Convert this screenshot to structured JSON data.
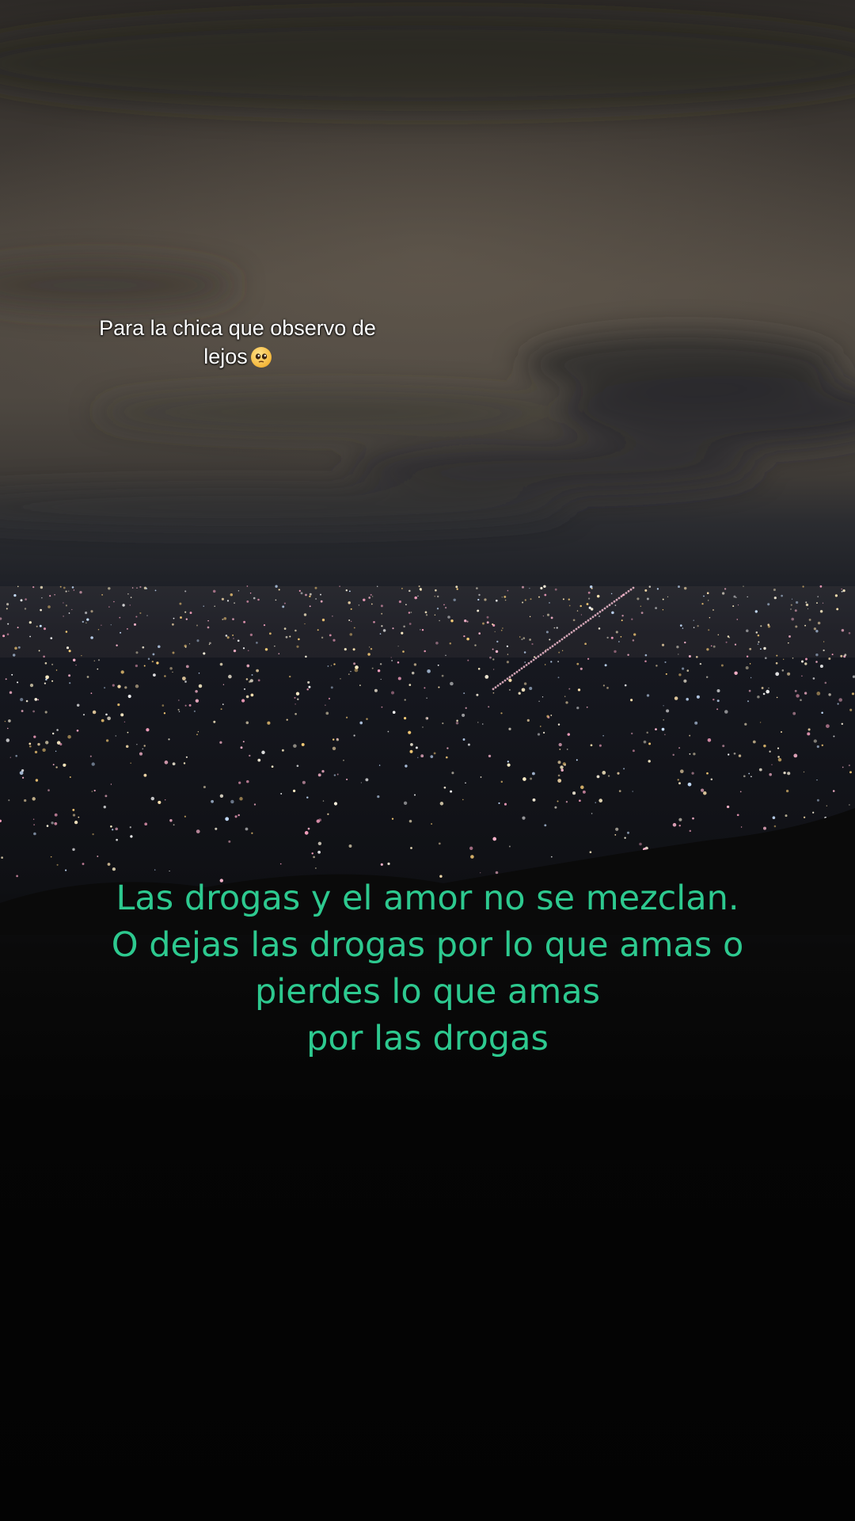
{
  "caption": {
    "text": "Para la chica que observo de lejos",
    "emoji_icon": "pleading-face-emoji"
  },
  "quote": {
    "lines": [
      "Las drogas y el amor no se mezclan.",
      "O dejas las drogas por lo que amas o",
      "pierdes lo que amas",
      "por las drogas"
    ],
    "color": "#2dc98f"
  }
}
